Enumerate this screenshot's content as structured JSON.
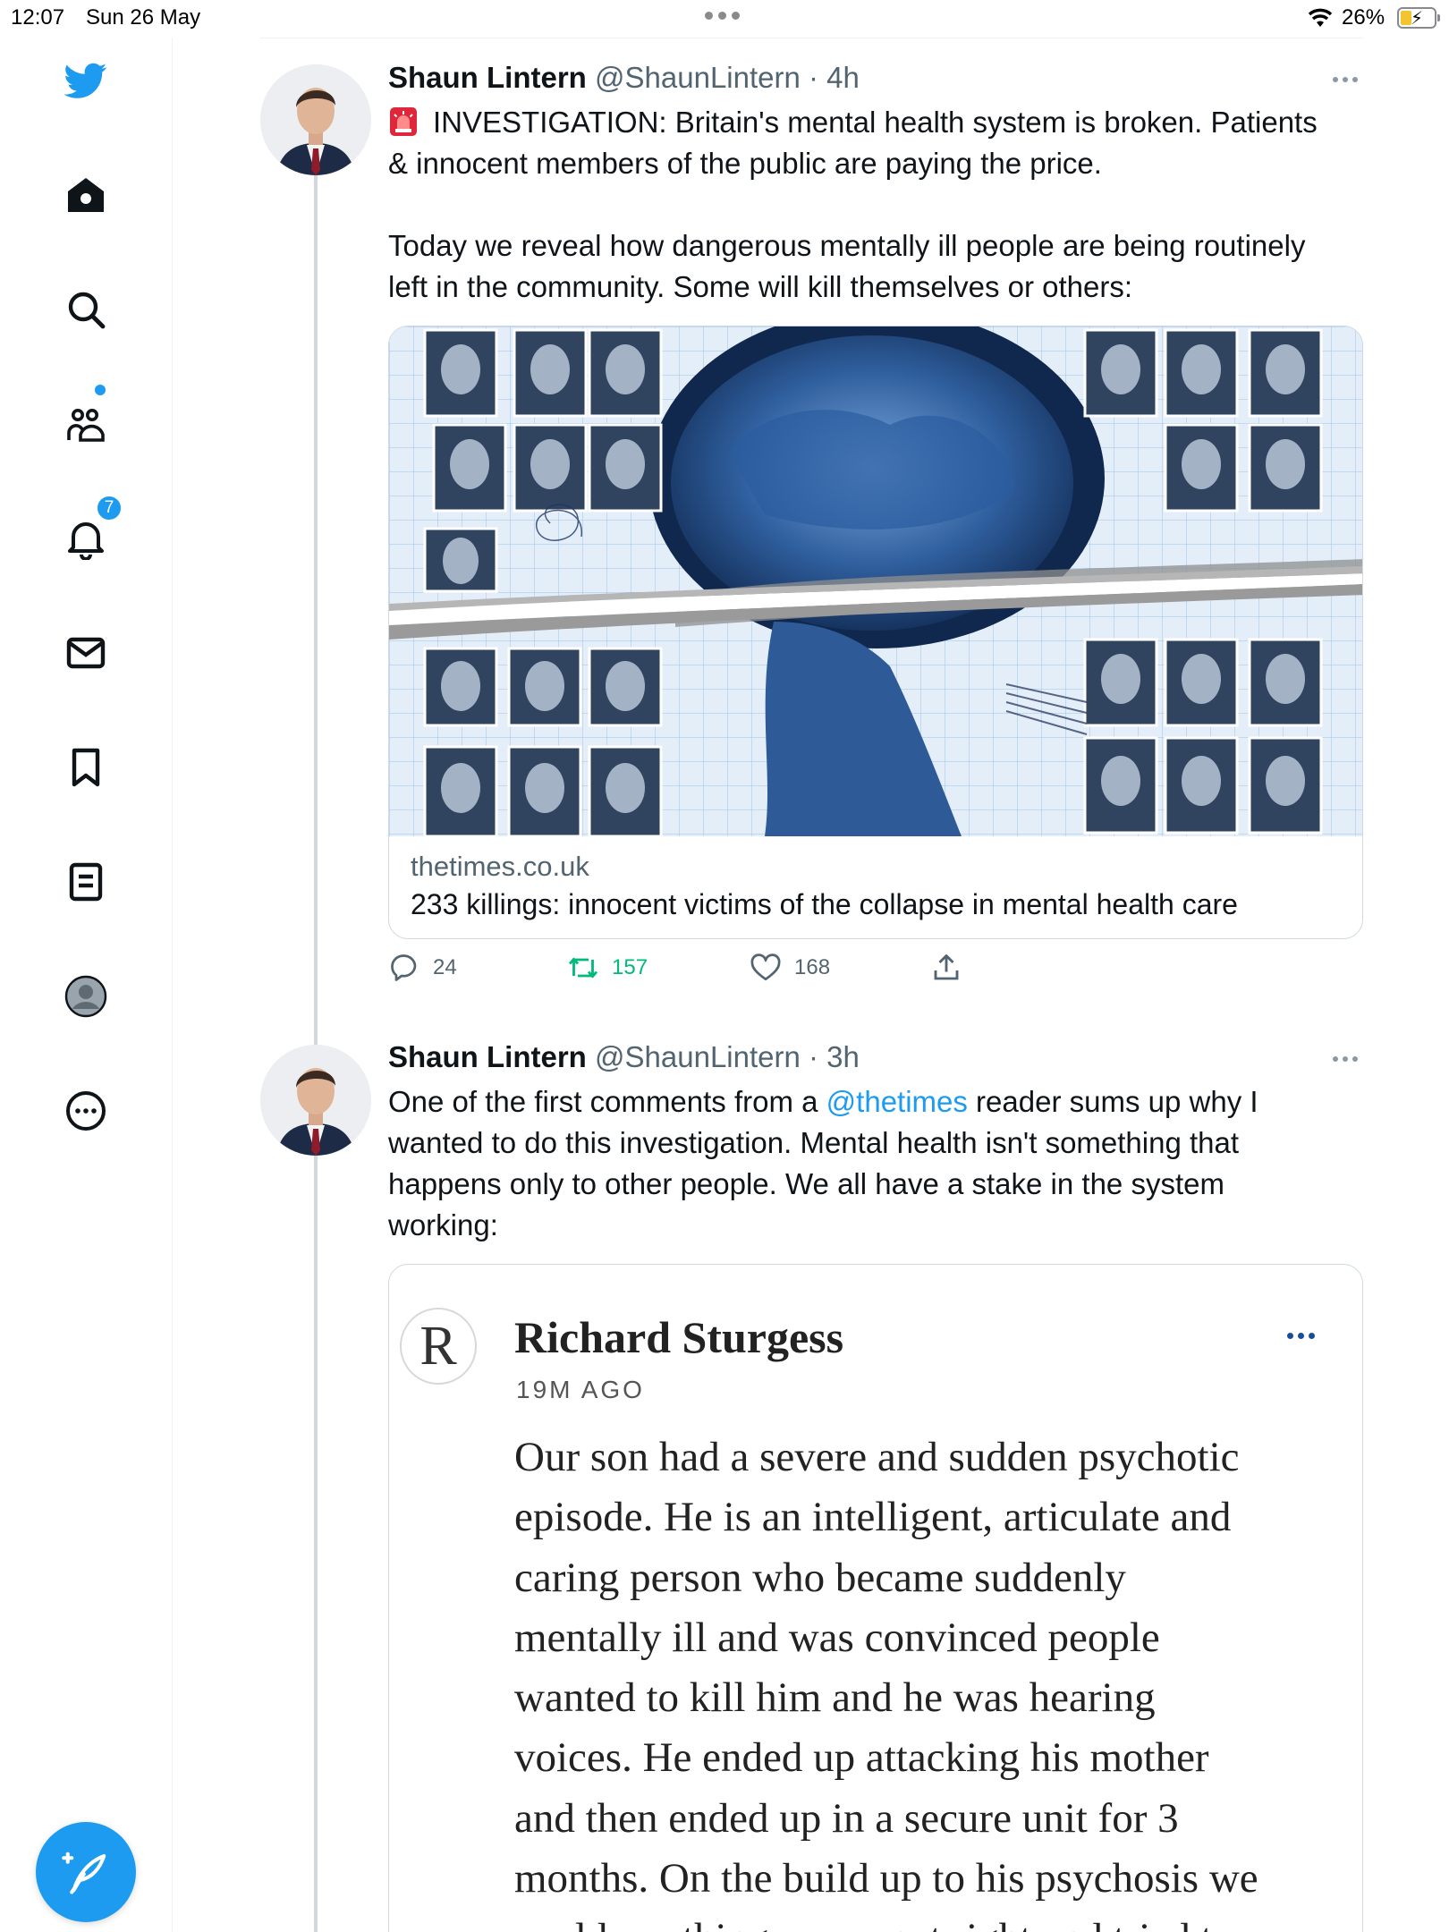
{
  "status_bar": {
    "time": "12:07",
    "date": "Sun 26 May",
    "battery": "26%"
  },
  "sidebar": {
    "items": [
      {
        "name": "twitter-logo"
      },
      {
        "name": "home"
      },
      {
        "name": "search"
      },
      {
        "name": "communities"
      },
      {
        "name": "notifications",
        "badge": "7"
      },
      {
        "name": "messages"
      },
      {
        "name": "bookmarks"
      },
      {
        "name": "lists"
      },
      {
        "name": "profile"
      },
      {
        "name": "more"
      }
    ],
    "compose_icon": "compose-icon"
  },
  "tweets": [
    {
      "name": "Shaun Lintern",
      "handle": "@ShaunLintern",
      "time": "· 4h",
      "text_lines": [
        "INVESTIGATION: Britain's mental health system is broken. Patients",
        "& innocent members of the public are paying the price.",
        "",
        "Today we reveal how dangerous mentally ill people are being routinely",
        "left in the community. Some will kill themselves or others:"
      ],
      "card": {
        "domain": "thetimes.co.uk",
        "title": "233 killings: innocent victims of the collapse in mental health care"
      },
      "actions": {
        "replies": "24",
        "retweets": "157",
        "likes": "168"
      }
    },
    {
      "name": "Shaun Lintern",
      "handle": "@ShaunLintern",
      "time": "· 3h",
      "text_pre": "One of the first comments from a ",
      "mention": "@thetimes",
      "text_post_1": " reader sums up why I",
      "text_lines": [
        "wanted to do this investigation. Mental health isn't something that",
        "happens only to other people. We all have a stake in the system",
        "working:"
      ],
      "quote": {
        "logo_letter": "R",
        "author": "Richard Sturgess",
        "time": "19M AGO",
        "body_lines": [
          "Our son had a severe and sudden psychotic",
          "episode. He is an intelligent, articulate and",
          "caring person who became suddenly",
          "mentally ill and was convinced people",
          "wanted to kill him and he was hearing",
          "voices. He ended up attacking his mother",
          "and then ended up in a secure unit for 3",
          "months. On the build up to his psychosis we",
          "could see things were not right and tried to"
        ]
      }
    }
  ],
  "colors": {
    "accent": "#1d9bf0",
    "retweet": "#00ba7c",
    "muted": "#536471"
  }
}
